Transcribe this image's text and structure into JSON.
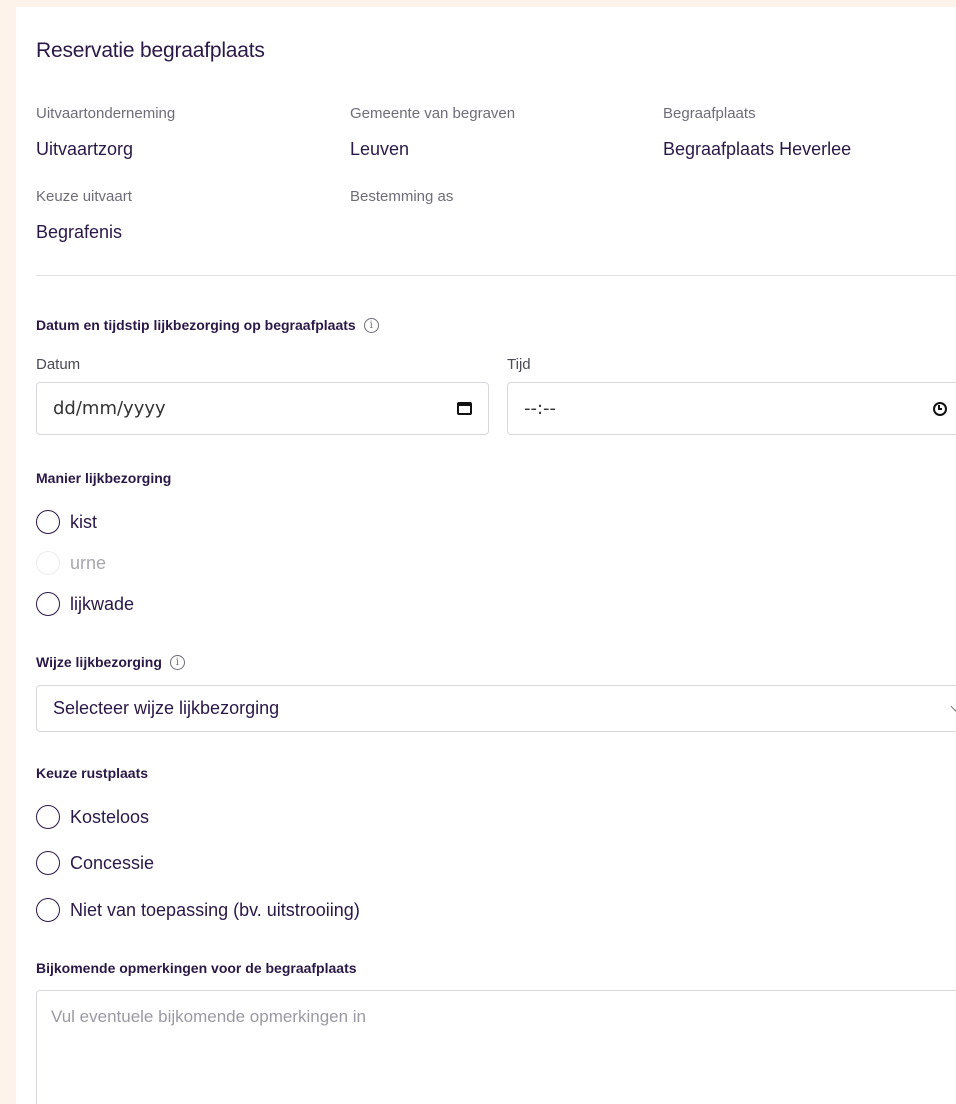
{
  "title": "Reservatie begraafplaats",
  "info": {
    "funeral_home_label": "Uitvaartonderneming",
    "funeral_home_value": "Uitvaartzorg",
    "municipality_label": "Gemeente van begraven",
    "municipality_value": "Leuven",
    "cemetery_label": "Begraafplaats",
    "cemetery_value": "Begraafplaats Heverlee",
    "funeral_choice_label": "Keuze uitvaart",
    "funeral_choice_value": "Begrafenis",
    "ash_destination_label": "Bestemming as"
  },
  "datetime": {
    "section_label": "Datum en tijdstip lijkbezorging op begraafplaats",
    "date_label": "Datum",
    "date_value": "dd/mm/yyyy",
    "time_label": "Tijd",
    "time_value": "--:--"
  },
  "manner": {
    "section_label": "Manier lijkbezorging",
    "options": [
      "kist",
      "urne",
      "lijkwade"
    ]
  },
  "method": {
    "section_label": "Wijze lijkbezorging",
    "select_value": "Selecteer wijze lijkbezorging"
  },
  "resting_place": {
    "section_label": "Keuze rustplaats",
    "options": [
      "Kosteloos",
      "Concessie",
      "Niet van toepassing (bv. uitstrooiing)"
    ]
  },
  "remarks": {
    "section_label": "Bijkomende opmerkingen voor de begraafplaats",
    "placeholder": "Vul eventuele bijkomende opmerkingen in"
  },
  "icons": {
    "info": "info-icon",
    "calendar": "calendar-icon",
    "clock": "clock-icon",
    "chevron": "chevron-down-icon"
  },
  "colors": {
    "page_background": "#fdf3ea",
    "text_primary": "#2a1847"
  }
}
